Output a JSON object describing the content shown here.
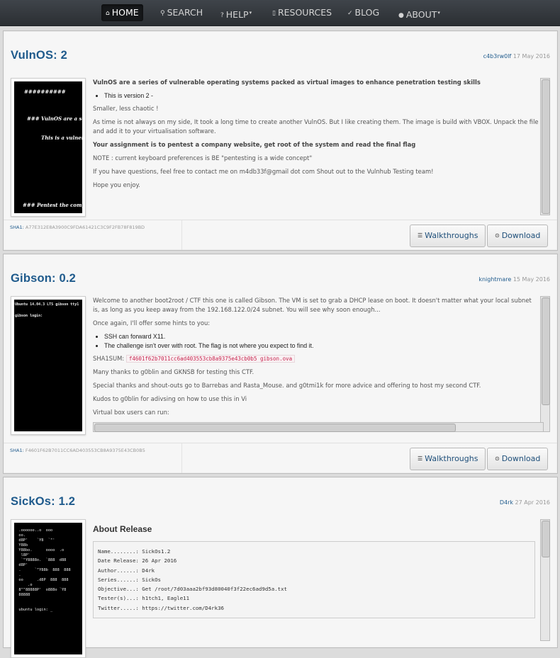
{
  "nav": {
    "items": [
      {
        "label": "HOME",
        "icon": "home-icon",
        "glyph": "⌂",
        "active": true
      },
      {
        "label": "SEARCH",
        "icon": "search-icon",
        "glyph": "⚲",
        "active": false
      },
      {
        "label": "HELP",
        "icon": "question-icon",
        "glyph": "?",
        "active": false,
        "dropdown": true
      },
      {
        "label": "RESOURCES",
        "icon": "file-icon",
        "glyph": "▯",
        "active": false
      },
      {
        "label": "BLOG",
        "icon": "check-icon",
        "glyph": "✓",
        "active": false
      },
      {
        "label": "ABOUT",
        "icon": "user-icon",
        "glyph": "●",
        "active": false,
        "dropdown": true
      }
    ]
  },
  "entries": [
    {
      "title": "VulnOS: 2",
      "author": "c4b3rw0lf",
      "date": "17 May 2016",
      "thumb_lines": [
        "##########",
        "### VulnOS are a series",
        "This is a vulnerabl",
        "### Pentest the company"
      ],
      "intro": "VulnOS are a series of vulnerable operating systems packed as virtual images to enhance penetration testing skills",
      "bullets": [
        "This is version 2 -"
      ],
      "p1": "Smaller, less chaotic !",
      "p2": "As time is not always on my side, It took a long time to create another VulnOS. But I like creating them. The image is build with VBOX. Unpack the file and add it to your virtualisation software.",
      "p3": "Your assignment is to pentest a company website, get root of the system and read the final flag",
      "p4": "NOTE : current keyboard preferences is BE \"pentesting is a wide concept\"",
      "p5": "If you have questions, feel free to contact me on m4db33f@gmail dot com Shout out to the Vulnhub Testing team!",
      "p6": "Hope you enjoy.",
      "sha_label": "SHA1:",
      "sha": "A77E312E8A3900C9FDA61421C3C9F2FB78F819BD",
      "walkthroughs": "Walkthroughs",
      "download": "Download"
    },
    {
      "title": "Gibson: 0.2",
      "author": "knightmare",
      "date": "15 May 2016",
      "thumb_lines": [
        "Ubuntu 14.04.3 LTS gibson tty1",
        "gibson login:"
      ],
      "p1": "Welcome to another boot2root / CTF this one is called Gibson. The VM is set to grab a DHCP lease on boot. It doesn't matter what your local subnet is, as long as you keep away from the 192.168.122.0/24 subnet. You will see why soon enough...",
      "p2": "Once again, I'll offer some hints to you:",
      "bullets": [
        "SSH can forward X11.",
        "The challenge isn't over with root. The flag is not where you expect to find it."
      ],
      "sha_prefix": "SHA1SUM:",
      "sha_code": "f4601f62b7011cc6ad403553cb8a9375e43cb0b5 gibson.ova",
      "p3": "Many thanks to g0blin and GKNSB for testing this CTF.",
      "p4": "Special thanks and shout-outs go to Barrebas and Rasta_Mouse. and g0tmi1k for more advice and offering to host my second CTF.",
      "p5": "Kudos to g0blin for adivsing on how to use this in Vi",
      "p6": "Virtual box users can run:",
      "sha_label": "SHA1:",
      "sha": "F4601F62B7011CC6AD403553CB8A9375E43CB0B5",
      "walkthroughs": "Walkthroughs",
      "download": "Download"
    },
    {
      "title": "SickOs: 1.2",
      "author": "D4rk",
      "date": "27 Apr 2016",
      "thumb_lines": [
        "  .oooooo..o  ooo",
        "  oo.",
        "  d8P'    `Y8  `\"'",
        "  Y88b",
        "  Y88bo.      oooo  .o",
        "   l8P'",
        "   `\"Y8888o.  `888  d88",
        "  d8P'",
        "  .      `\"Y88b  888  888",
        "  .",
        "  oo      .d8P  888  888",
        "      .o",
        "  8\"\"88888P'  o888o `Y8",
        "  88888",
        "",
        "",
        "  ubuntu login: _"
      ],
      "release_title": "About Release",
      "pre_lines": [
        "Name........: SickOs1.2",
        "Date Release: 26 Apr 2016",
        "Author......: D4rk",
        "Series......: SickOs",
        "Objective...: Get /root/7d03aaa2bf93d80040f3f22ec6ad9d5a.txt",
        "Tester(s)...: h1tch1, Eagle11",
        "Twitter.....: https://twitter.com/D4rk36"
      ]
    }
  ],
  "colors": {
    "link": "#1e5a8c",
    "navbar": "#2b2f33",
    "panel": "#f6f6f6",
    "code": "#c7254e"
  }
}
